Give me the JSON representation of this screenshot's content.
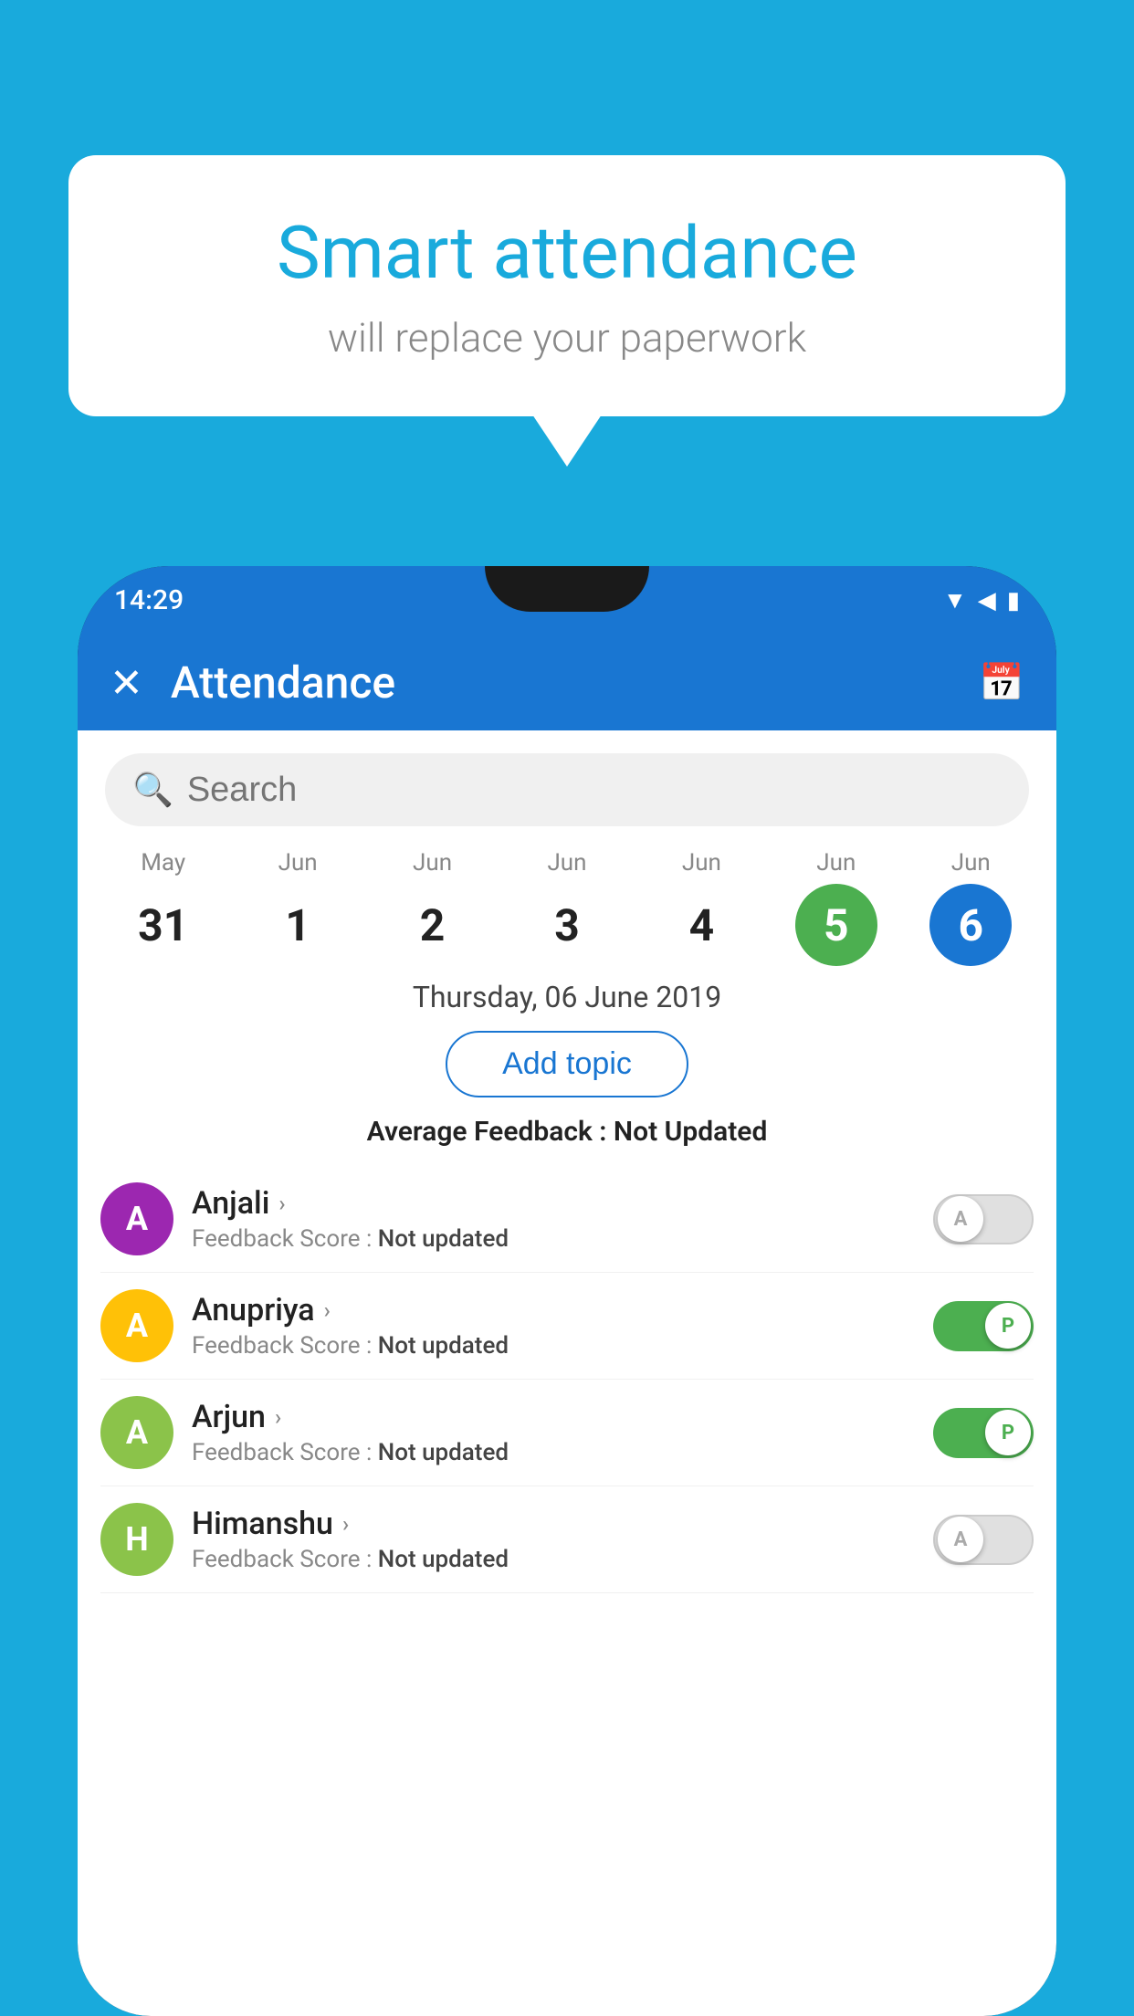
{
  "background_color": "#19AADC",
  "speech_bubble": {
    "title": "Smart attendance",
    "subtitle": "will replace your paperwork"
  },
  "status_bar": {
    "time": "14:29",
    "wifi_icon": "▲",
    "signal_icon": "▲",
    "battery_icon": "▮"
  },
  "app_header": {
    "close_label": "✕",
    "title": "Attendance",
    "calendar_icon": "📅"
  },
  "search": {
    "placeholder": "Search"
  },
  "dates": [
    {
      "month": "May",
      "day": "31",
      "style": "normal"
    },
    {
      "month": "Jun",
      "day": "1",
      "style": "normal"
    },
    {
      "month": "Jun",
      "day": "2",
      "style": "normal"
    },
    {
      "month": "Jun",
      "day": "3",
      "style": "normal"
    },
    {
      "month": "Jun",
      "day": "4",
      "style": "normal"
    },
    {
      "month": "Jun",
      "day": "5",
      "style": "green"
    },
    {
      "month": "Jun",
      "day": "6",
      "style": "blue"
    }
  ],
  "selected_date": "Thursday, 06 June 2019",
  "add_topic_label": "Add topic",
  "average_feedback_label": "Average Feedback :",
  "average_feedback_value": "Not Updated",
  "students": [
    {
      "name": "Anjali",
      "initial": "A",
      "avatar_color": "#9C27B0",
      "feedback_label": "Feedback Score :",
      "feedback_value": "Not updated",
      "toggle": "off",
      "toggle_label": "A"
    },
    {
      "name": "Anupriya",
      "initial": "A",
      "avatar_color": "#FFC107",
      "feedback_label": "Feedback Score :",
      "feedback_value": "Not updated",
      "toggle": "on",
      "toggle_label": "P"
    },
    {
      "name": "Arjun",
      "initial": "A",
      "avatar_color": "#8BC34A",
      "feedback_label": "Feedback Score :",
      "feedback_value": "Not updated",
      "toggle": "on",
      "toggle_label": "P"
    },
    {
      "name": "Himanshu",
      "initial": "H",
      "avatar_color": "#8BC34A",
      "feedback_label": "Feedback Score :",
      "feedback_value": "Not updated",
      "toggle": "off",
      "toggle_label": "A"
    }
  ]
}
